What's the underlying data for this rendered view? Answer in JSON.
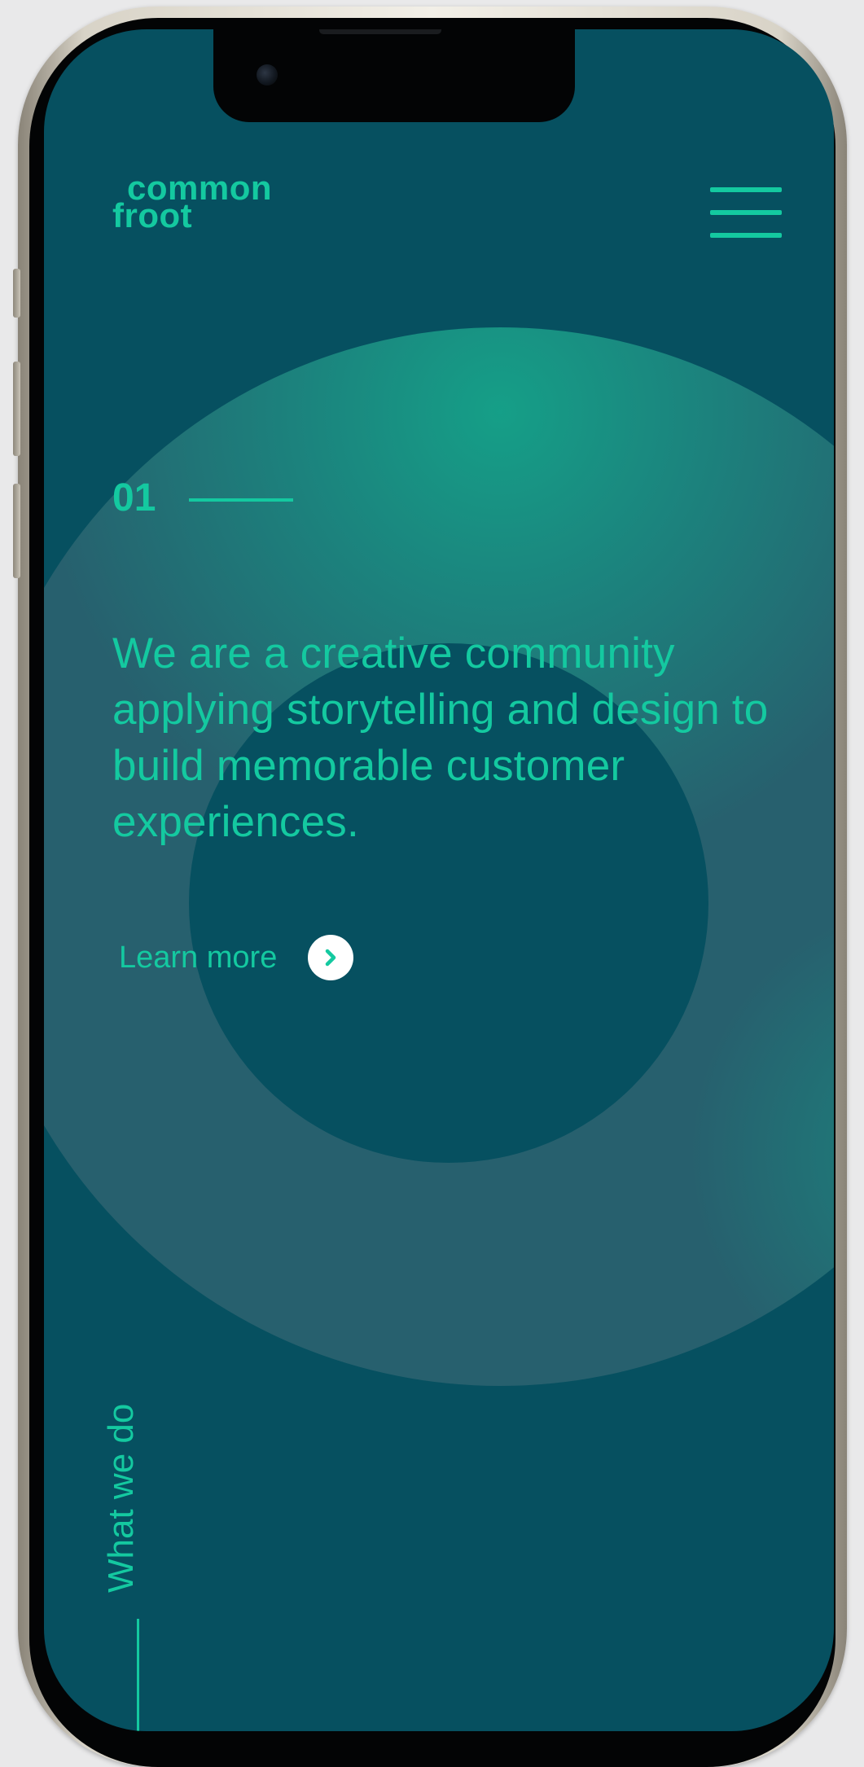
{
  "brand": {
    "logo_line1": "common",
    "logo_line2": "froot"
  },
  "header": {
    "menu_icon": "hamburger-menu-icon"
  },
  "hero": {
    "section_number": "01",
    "headline": "We are a creative community applying storytelling and design to build memorable customer experiences.",
    "cta_label": "Learn more",
    "cta_icon": "chevron-right-icon"
  },
  "side_label": "What we do",
  "colors": {
    "background": "#065060",
    "accent": "#14c9a0",
    "ring": "#27606e",
    "cta_circle": "#ffffff"
  }
}
